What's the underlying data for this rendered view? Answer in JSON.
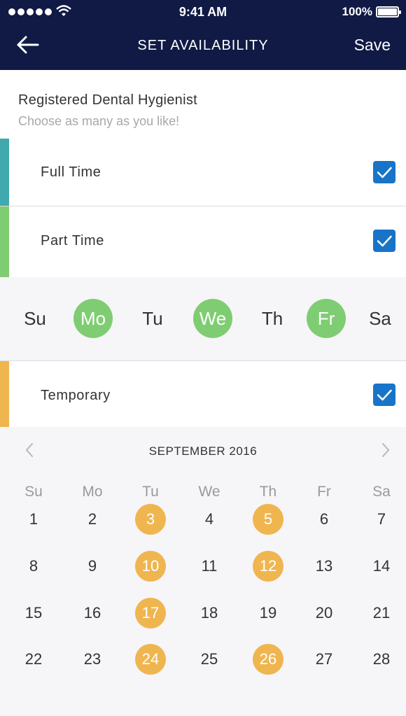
{
  "status_bar": {
    "time": "9:41 AM",
    "battery": "100%"
  },
  "nav": {
    "title": "SET AVAILABILITY",
    "save_label": "Save",
    "back_icon": "arrow-left-icon"
  },
  "section": {
    "title": "Registered Dental Hygienist",
    "subtitle": "Choose as many as you like!"
  },
  "options": [
    {
      "label": "Full Time",
      "checked": true,
      "color": "#3fa9ae"
    },
    {
      "label": "Part Time",
      "checked": true,
      "color": "#7fcd72"
    },
    {
      "label": "Temporary",
      "checked": true,
      "color": "#efb54f"
    }
  ],
  "weekdays": [
    {
      "label": "Su",
      "selected": false
    },
    {
      "label": "Mo",
      "selected": true
    },
    {
      "label": "Tu",
      "selected": false
    },
    {
      "label": "We",
      "selected": true
    },
    {
      "label": "Th",
      "selected": false
    },
    {
      "label": "Fr",
      "selected": true
    },
    {
      "label": "Sa",
      "selected": false
    }
  ],
  "calendar": {
    "month": "SEPTEMBER 2016",
    "day_headers": [
      "Su",
      "Mo",
      "Tu",
      "We",
      "Th",
      "Fr",
      "Sa"
    ],
    "weeks": [
      [
        "1",
        "2",
        "3",
        "4",
        "5",
        "6",
        "7"
      ],
      [
        "8",
        "9",
        "10",
        "11",
        "12",
        "13",
        "14"
      ],
      [
        "15",
        "16",
        "17",
        "18",
        "19",
        "20",
        "21"
      ],
      [
        "22",
        "23",
        "24",
        "25",
        "26",
        "27",
        "28"
      ]
    ],
    "selected_days": [
      "3",
      "5",
      "10",
      "12",
      "17",
      "24",
      "26"
    ]
  },
  "colors": {
    "header_bg": "#101a45",
    "checkbox": "#1874c8",
    "weekday_selected": "#7fcd72",
    "date_selected": "#efb54f"
  }
}
